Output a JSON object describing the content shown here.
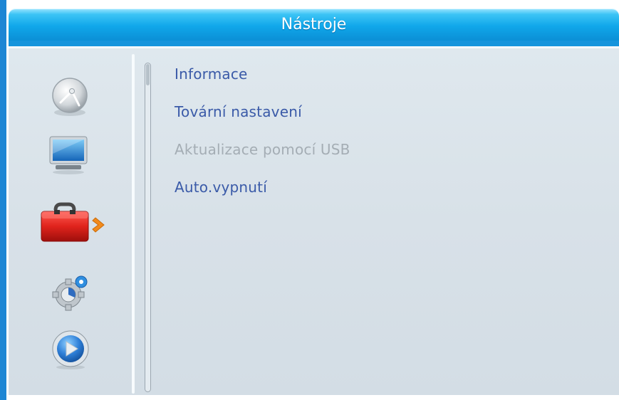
{
  "window": {
    "title": "Nástroje"
  },
  "sidebar": {
    "items": [
      {
        "icon": "satellite-dish-icon",
        "selected": false
      },
      {
        "icon": "tv-monitor-icon",
        "selected": false
      },
      {
        "icon": "toolbox-icon",
        "selected": true
      },
      {
        "icon": "gear-settings-icon",
        "selected": false
      },
      {
        "icon": "play-media-icon",
        "selected": false
      }
    ],
    "selection_indicator": "chevron-right-icon"
  },
  "menu": {
    "items": [
      {
        "label": "Informace",
        "enabled": true
      },
      {
        "label": "Tovární nastavení",
        "enabled": true
      },
      {
        "label": "Aktualizace pomocí USB",
        "enabled": false
      },
      {
        "label": "Auto.vypnutí",
        "enabled": true
      }
    ]
  },
  "colors": {
    "title_bar": "#10a7ea",
    "menu_text": "#3a5aa8",
    "menu_text_disabled": "#a4adb4",
    "panel_background": "#d8e1e8",
    "selection_arrow": "#f28a1b"
  }
}
